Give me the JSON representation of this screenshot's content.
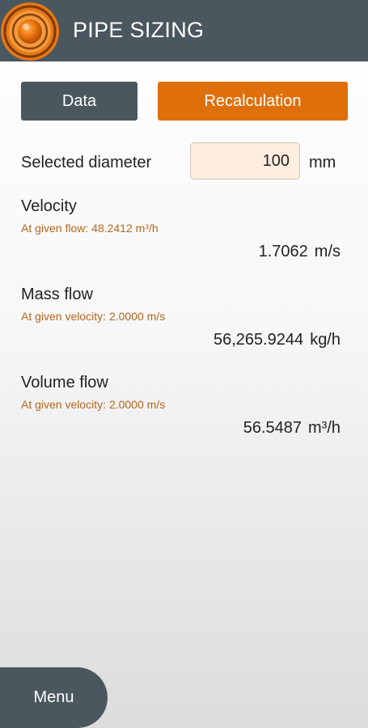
{
  "header": {
    "title": "PIPE SIZING",
    "logo_icon": "orange-sphere-logo-icon"
  },
  "tabs": {
    "data_label": "Data",
    "recalc_label": "Recalculation"
  },
  "diameter": {
    "label": "Selected diameter",
    "value": "100",
    "unit": "mm"
  },
  "velocity": {
    "title": "Velocity",
    "subtitle": "At given flow: 48.2412 m³/h",
    "value": "1.7062",
    "unit": "m/s"
  },
  "mass_flow": {
    "title": "Mass flow",
    "subtitle": "At given velocity: 2.0000 m/s",
    "value": "56,265.9244",
    "unit": "kg/h"
  },
  "volume_flow": {
    "title": "Volume flow",
    "subtitle": "At given velocity: 2.0000 m/s",
    "value": "56.5487",
    "unit": "m³/h"
  },
  "menu": {
    "label": "Menu"
  },
  "colors": {
    "header": "#4a575e",
    "accent": "#df6f0b",
    "subtitle": "#b5651d",
    "input_bg": "#fdeee0"
  }
}
